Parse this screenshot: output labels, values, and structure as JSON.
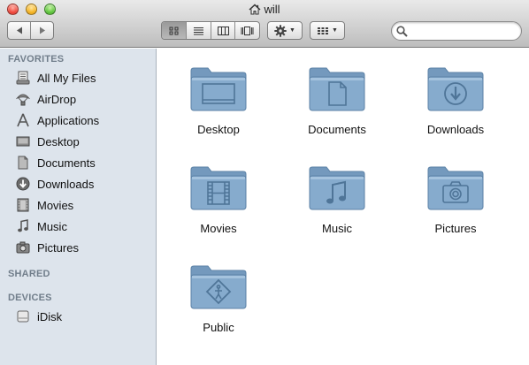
{
  "window": {
    "title": "will",
    "title_icon": "home-icon"
  },
  "toolbar": {
    "back_icon": "back-arrow-icon",
    "forward_icon": "forward-arrow-icon",
    "view_modes": [
      "icon-view",
      "list-view",
      "column-view",
      "coverflow-view"
    ],
    "active_view": "icon-view",
    "action_icon": "gear-icon",
    "arrange_icon": "arrange-grid-icon",
    "search": {
      "placeholder": "",
      "value": ""
    }
  },
  "sidebar": {
    "favorites_header": "FAVORITES",
    "favorites": [
      {
        "label": "All My Files",
        "icon": "all-my-files-icon"
      },
      {
        "label": "AirDrop",
        "icon": "airdrop-icon"
      },
      {
        "label": "Applications",
        "icon": "applications-icon"
      },
      {
        "label": "Desktop",
        "icon": "desktop-icon"
      },
      {
        "label": "Documents",
        "icon": "documents-icon"
      },
      {
        "label": "Downloads",
        "icon": "downloads-icon"
      },
      {
        "label": "Movies",
        "icon": "movies-icon"
      },
      {
        "label": "Music",
        "icon": "music-icon"
      },
      {
        "label": "Pictures",
        "icon": "pictures-icon"
      }
    ],
    "shared_header": "SHARED",
    "devices_header": "DEVICES",
    "devices": [
      {
        "label": "iDisk",
        "icon": "idisk-icon"
      }
    ]
  },
  "main": {
    "folders": [
      {
        "label": "Desktop",
        "icon": "desktop-folder-icon"
      },
      {
        "label": "Documents",
        "icon": "documents-folder-icon"
      },
      {
        "label": "Downloads",
        "icon": "downloads-folder-icon"
      },
      {
        "label": "Movies",
        "icon": "movies-folder-icon"
      },
      {
        "label": "Music",
        "icon": "music-folder-icon"
      },
      {
        "label": "Pictures",
        "icon": "pictures-folder-icon"
      },
      {
        "label": "Public",
        "icon": "public-folder-icon"
      }
    ]
  },
  "colors": {
    "sidebar_bg": "#dde4ec",
    "section_header": "#717e8b",
    "folder_blue": "#7fa6c8"
  }
}
